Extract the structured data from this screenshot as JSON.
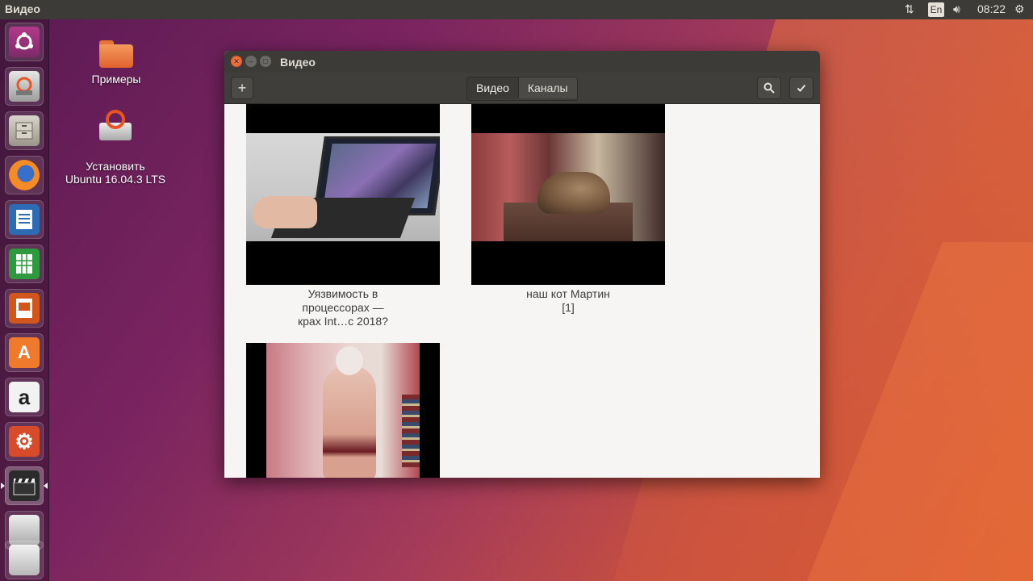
{
  "top_panel": {
    "title": "Видео",
    "language": "En",
    "time": "08:22",
    "icons": [
      "network-updown-icon",
      "volume-icon",
      "power-gear-icon"
    ]
  },
  "launcher": {
    "items": [
      {
        "name": "ubuntu-dash"
      },
      {
        "name": "ubuntu-installer"
      },
      {
        "name": "files"
      },
      {
        "name": "firefox"
      },
      {
        "name": "libreoffice-writer"
      },
      {
        "name": "libreoffice-calc"
      },
      {
        "name": "libreoffice-impress"
      },
      {
        "name": "ubuntu-software"
      },
      {
        "name": "amazon"
      },
      {
        "name": "system-settings"
      },
      {
        "name": "videos"
      },
      {
        "name": "drive"
      },
      {
        "name": "trash"
      }
    ]
  },
  "desktop": {
    "icons": [
      {
        "label": "Примеры",
        "icon": "folder-icon"
      },
      {
        "label": "Установить\nUbuntu 16.04.3 LTS",
        "icon": "installer-icon"
      }
    ]
  },
  "window": {
    "title": "Видео",
    "toolbar": {
      "add_label": "+",
      "tabs": [
        {
          "label": "Видео",
          "active": true
        },
        {
          "label": "Каналы",
          "active": false
        }
      ],
      "search_icon": "search-icon",
      "select_icon": "checkmark-icon"
    },
    "videos": [
      {
        "caption": "Уязвимость в процессорах — крах Int…с 2018?"
      },
      {
        "caption": "наш кот Мартин [1]"
      },
      {
        "caption": ""
      }
    ]
  },
  "colors": {
    "panel": "#3c3b37",
    "accent": "#e95420",
    "content_bg": "#f6f5f4"
  }
}
